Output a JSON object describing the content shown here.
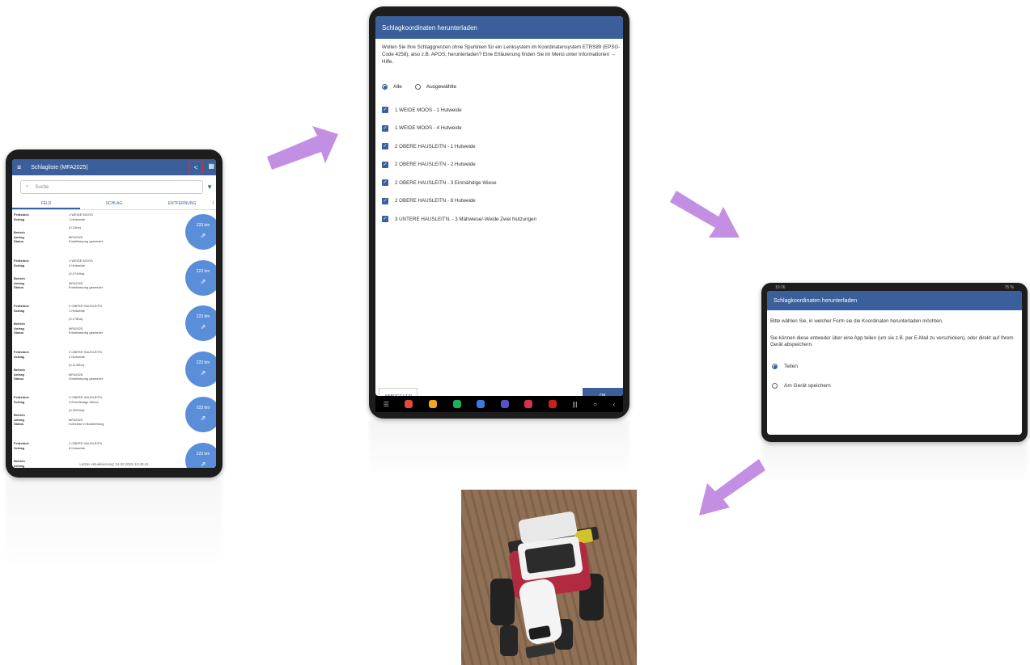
{
  "device1": {
    "status_bar": {
      "time": "12:29",
      "right": "74 %"
    },
    "title": "Schlagliste (MFA2025)",
    "icons": {
      "menu": "hamburger-icon",
      "share": "share-icon",
      "map": "map-icon",
      "filter": "filter-icon",
      "sort": "sort-icon"
    },
    "search_placeholder": "Suche",
    "tabs": [
      "FELD",
      "SCHLAG",
      "ENTFERNUNG"
    ],
    "row_labels": [
      "Feldstück",
      "Schlag",
      "Betrieb",
      "Antrag",
      "Status"
    ],
    "rows": [
      {
        "feld": "1 WEIDE MOOS",
        "schlag": "1 Hutweide",
        "flaeche": "(0.15ha)",
        "antrag": "MFA2025",
        "status": "Erstelfassung gesendet",
        "km": "223 km"
      },
      {
        "feld": "1 WEIDE MOOS",
        "schlag": "4 Hutweide",
        "flaeche": "(0.0749ha)",
        "antrag": "MFA2025",
        "status": "Erstelfassung gesendet",
        "km": "223 km"
      },
      {
        "feld": "2 OBERE HAUSLEITN",
        "schlag": "1 Hutweide",
        "flaeche": "(0.178ha)",
        "antrag": "MFA2025",
        "status": "Erstelfassung gesendet",
        "km": "223 km"
      },
      {
        "feld": "2 OBERE HAUSLEITN",
        "schlag": "2 Hutweide",
        "flaeche": "(0.1149ha)",
        "antrag": "MFA2025",
        "status": "Erstelfassung gesendet",
        "km": "223 km"
      },
      {
        "feld": "2 OBERE HAUSLEITN",
        "schlag": "3 Einmähdige Wiese",
        "flaeche": "(0.3209ha)",
        "antrag": "MFA2025",
        "status": "Korrektur in Bearbeitung",
        "km": "223 km"
      },
      {
        "feld": "2 OBERE HAUSLEITN",
        "schlag": "8 Hutweide",
        "flaeche": "",
        "antrag": "",
        "status": "",
        "km": "223 km"
      }
    ],
    "footer": "Letzte Aktualisierung: 24.02.2025 13:40:41"
  },
  "device2": {
    "title": "Schlagkoordinaten herunterladen",
    "intro": "Wollen Sie Ihre Schlaggrenzen ohne Spurlinien für ein Lenksystem im Koordinatensystem ETRS89 (EPSG-Code 4258), also z.B. APOS, herunterladen? Eine Erläuterung finden Sie im Menü unter Informationen → Hilfe.",
    "radio_all": "Alle",
    "radio_selected": "Ausgewählte",
    "items": [
      "1 WEIDE MOOS - 1 Hutweide",
      "1 WEIDE MOOS - 4 Hutweide",
      "2 OBERE HAUSLEITN - 1 Hutweide",
      "2 OBERE HAUSLEITN - 2 Hutweide",
      "2 OBERE HAUSLEITN - 3 Einmähdige Wiese",
      "2 OBERE HAUSLEITN - 8 Hutweide",
      "3 UNTERE HAUSLEITN. - 3 Mähwiese/-Weide Zwei Nutzungen"
    ],
    "cancel_label": "ABBRECHEN",
    "ok_label": "OK",
    "nav_icons": [
      "recents-icon",
      "home-icon",
      "back-icon"
    ],
    "app_colors": [
      "#e24a3b",
      "#f3a81c",
      "#1bb35a",
      "#3a7be0",
      "#5b4fd1",
      "#d8324b",
      "#c9201e"
    ]
  },
  "device3": {
    "status_bar": {
      "time": "10:26",
      "right": "75 %"
    },
    "title": "Schlagkoordinaten herunterladen",
    "text1": "Bitte wählen Sie, in welcher Form sie die Koordinaten herunterladen möchten.",
    "text2": "Sie können diese entweder über eine App teilen (um sie z.B. per E-Mail zu verschicken), oder direkt auf Ihrem Gerät abspeichern.",
    "option_share": "Teilen",
    "option_save": "Am Gerät speichern"
  },
  "colors": {
    "appbar": "#3b5f9a",
    "arrow": "#c38fe3",
    "fab": "#5b8ed8"
  }
}
